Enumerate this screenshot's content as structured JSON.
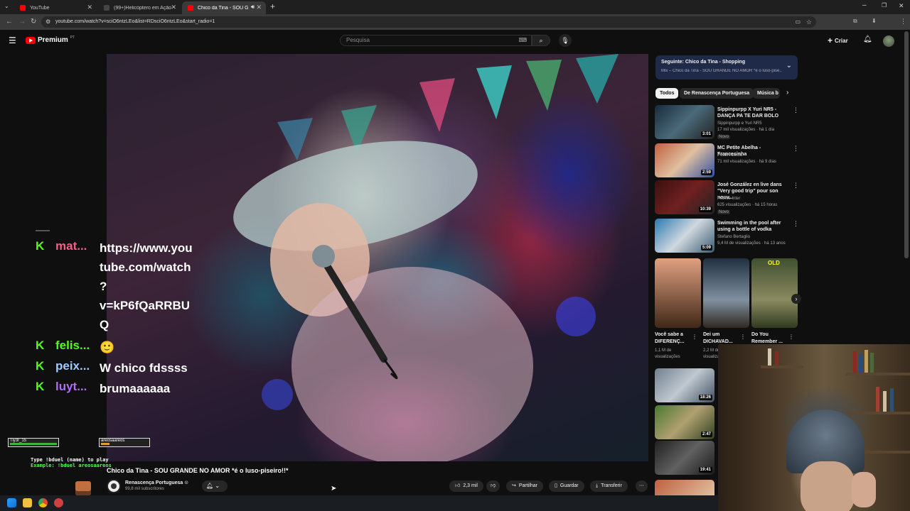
{
  "browser": {
    "tabs": [
      {
        "title": "YouTube",
        "color": "#ff0000"
      },
      {
        "title": "(99+)Helicóptero em Ação | Tik",
        "color": "#222222"
      },
      {
        "title": "Chico da Tina - SOU GRANDE",
        "color": "#ff0000"
      }
    ],
    "url": "youtube.com/watch?v=sciO6ntzLEo&list=RDsciO6ntzLEo&start_radio=1"
  },
  "youtube": {
    "logo_text": "Premium",
    "logo_sup": "PT",
    "search_placeholder": "Pesquisa",
    "create_label": "Criar",
    "brand_color": "#ff0000"
  },
  "chat": {
    "messages": [
      {
        "user": "mat...",
        "color": "#ff5a8c",
        "lines": [
          "https://www.you",
          "tube.com/watch",
          "?",
          "v=kP6fQaRRBU",
          "Q"
        ]
      },
      {
        "user": "felis...",
        "color": "#53fc18",
        "text": "🙂"
      },
      {
        "user": "peix...",
        "color": "#9ecbff",
        "text": "W chico fdssss"
      },
      {
        "user": "luyt...",
        "color": "#b06bff",
        "text": "brumaaaaaa"
      }
    ],
    "duel_left": "Tiy3r_15",
    "duel_right": "areosaareos",
    "duel_line1": "Type !bduel (name) to play",
    "duel_line2": "Example: !bduel areosaareos"
  },
  "video": {
    "title": "Chico da Tina - SOU GRANDE NO AMOR *é o luso-piseiro!!*",
    "channel": "Renascença Portuguesa",
    "subscribers": "99,8 mil subscritores",
    "likes": "2,3 mil",
    "share_label": "Partilhar",
    "save_label": "Guardar",
    "download_label": "Transferir"
  },
  "next": {
    "heading": "Seguinte: Chico da Tina - Shopping",
    "subtitle": "Mix – Chico da Tina - SOU GRANDE NO AMOR *é o luso-pise..."
  },
  "chips": [
    "Todos",
    "De Renascença Portuguesa",
    "Música b"
  ],
  "recommendations": [
    {
      "title": "Sippinpurpp X Yuri NR5 - DANÇA PA TE DAR BOLO",
      "channel": "Sippinpurpp e Yuri NR5",
      "meta": "17 mil visualizações · há 1 dia",
      "badge": "Novo",
      "duration": "3:01"
    },
    {
      "title": "MC Petite Abelha - Francesinha",
      "channel": "Petite Abelha",
      "meta": "71 mil visualizações · há 9 dias",
      "badge": "",
      "duration": "2:59"
    },
    {
      "title": "José González en live dans \"Very good trip\" pour son nouv...",
      "channel": "France Inter",
      "meta": "625 visualizações · há 15 horas",
      "badge": "Novo",
      "duration": "10:39"
    },
    {
      "title": "Swimming in the pool after using a bottle of vodka",
      "channel": "Stefano Bertaglio",
      "meta": "9,4 M de visualizações · há 13 anos",
      "badge": "",
      "duration": "5:09"
    }
  ],
  "shorts": [
    {
      "title": "Você sabe a DIFERENÇ...",
      "views": "1,1 M de visualizações"
    },
    {
      "title": "Dei um DICHAVAD...",
      "views": "2,2 M de visualizações"
    },
    {
      "title": "Do You Remember ...",
      "views": ""
    }
  ],
  "more_durations": [
    "18:26",
    "2:47",
    "19:41"
  ]
}
